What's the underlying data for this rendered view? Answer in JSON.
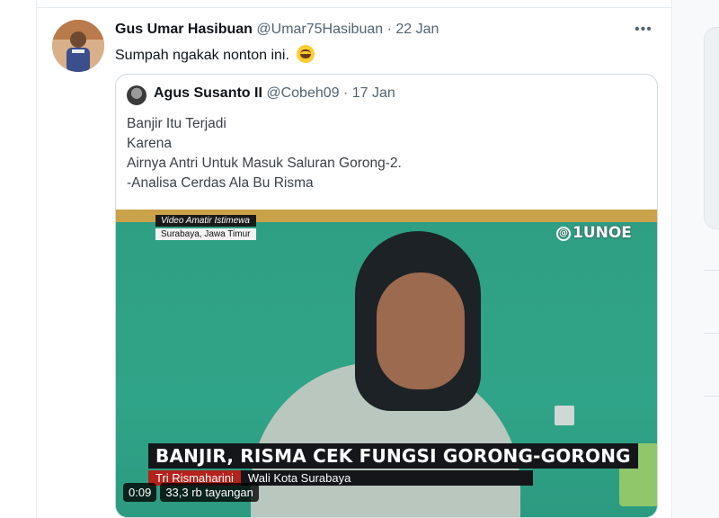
{
  "tweet": {
    "author_name": "Gus Umar Hasibuan",
    "author_handle": "@Umar75Hasibuan",
    "separator": "·",
    "date": "22 Jan",
    "more_icon": "•••",
    "text": "Sumpah ngakak nonton ini.",
    "emoji": "grinning-squinting-face"
  },
  "quoted_tweet": {
    "author_name": "Agus Susanto II",
    "author_handle": "@Cobeh09",
    "separator": "·",
    "date": "17 Jan",
    "lines": [
      "Banjir Itu Terjadi",
      "Karena",
      "Airnya Antri Untuk Masuk Saluran Gorong-2.",
      "-Analisa Cerdas Ala Bu Risma"
    ]
  },
  "video": {
    "tag_top": "Video Amatir Istimewa",
    "tag_location": "Surabaya, Jawa Timur",
    "channel_logo_mark": "@",
    "channel_logo": "1UNOE",
    "headline": "BANJIR, RISMA CEK FUNGSI GORONG-GORONG",
    "person_name": "Tri Rismaharini",
    "person_role": "Wali Kota Surabaya",
    "duration": "0:09",
    "views": "33,3 rb tayangan"
  }
}
